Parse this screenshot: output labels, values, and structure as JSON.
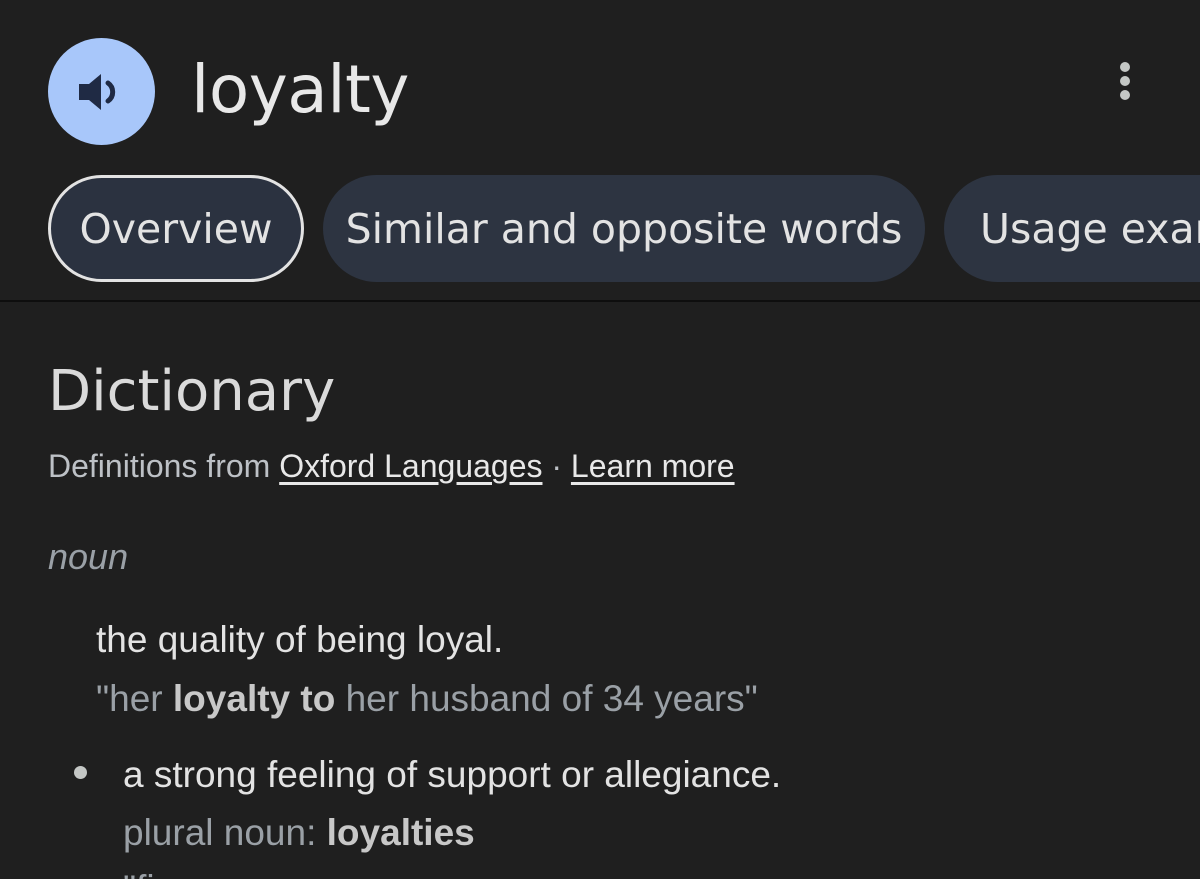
{
  "header": {
    "word": "loyalty",
    "speaker_icon": "speaker-icon",
    "more_icon": "more-vert-icon"
  },
  "tabs": [
    {
      "label": "Overview",
      "active": true
    },
    {
      "label": "Similar and opposite words",
      "active": false
    },
    {
      "label": "Usage exan",
      "active": false
    }
  ],
  "dictionary": {
    "title": "Dictionary",
    "source_prefix": "Definitions from",
    "source_link": "Oxford Languages",
    "separator": "·",
    "learn_more": "Learn more",
    "part_of_speech": "noun",
    "definition_1": "the quality of being loyal.",
    "example_1": {
      "open_quote": "\"her",
      "bold": "loyalty to",
      "rest": "her husband of 34 years\""
    },
    "definition_2": "a strong feeling of support or allegiance.",
    "plural_label": "plural noun:",
    "plural_value": "loyalties",
    "example_2_partial": "\"fi"
  },
  "colors": {
    "background": "#1f1f1f",
    "accent_button": "#a8c7fa",
    "tab_background": "#2d3441",
    "text_primary": "#e3e3e3",
    "text_secondary": "#9aa0a6"
  }
}
